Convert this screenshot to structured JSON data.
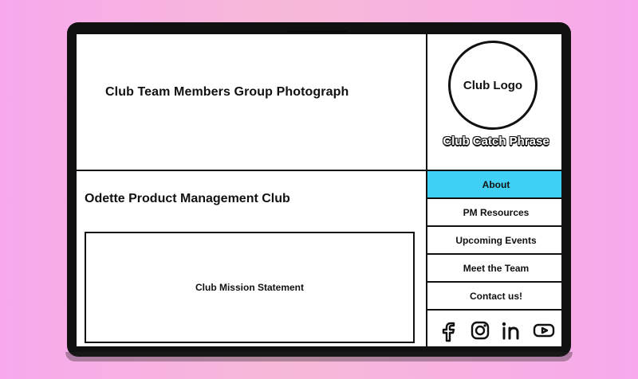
{
  "hero": {
    "label": "Club Team Members Group Photograph"
  },
  "brand": {
    "logo_text": "Club Logo",
    "catch_phrase": "Club Catch Phrase"
  },
  "content": {
    "club_name": "Odette Product Management Club",
    "mission_label": "Club Mission Statement"
  },
  "nav": {
    "items": [
      {
        "label": "About",
        "active": true
      },
      {
        "label": "PM Resources",
        "active": false
      },
      {
        "label": "Upcoming Events",
        "active": false
      },
      {
        "label": "Meet the Team",
        "active": false
      },
      {
        "label": "Contact us!",
        "active": false
      }
    ]
  },
  "social": {
    "icons": [
      "facebook-icon",
      "instagram-icon",
      "linkedin-icon",
      "youtube-icon"
    ]
  },
  "colors": {
    "background_left": "#f7a9ec",
    "background_mid": "#f7b9d8",
    "active_nav": "#41d0f5",
    "frame": "#111111"
  }
}
